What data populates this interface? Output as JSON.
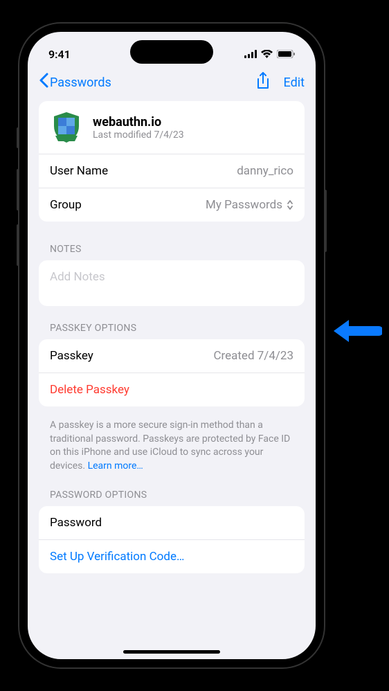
{
  "status": {
    "time": "9:41"
  },
  "nav": {
    "back_label": "Passwords",
    "edit_label": "Edit"
  },
  "site": {
    "name": "webauthn.io",
    "modified_label": "Last modified 7/4/23"
  },
  "details": {
    "username_label": "User Name",
    "username_value": "danny_rico",
    "group_label": "Group",
    "group_value": "My Passwords"
  },
  "notes": {
    "header": "NOTES",
    "placeholder": "Add Notes"
  },
  "passkey": {
    "header": "PASSKEY OPTIONS",
    "label": "Passkey",
    "created": "Created 7/4/23",
    "delete_label": "Delete Passkey",
    "footer": "A passkey is a more secure sign-in method than a traditional password. Passkeys are protected by Face ID on this iPhone and use iCloud to sync across your devices. ",
    "learn_more": "Learn more…"
  },
  "password": {
    "header": "PASSWORD OPTIONS",
    "label": "Password",
    "verification_label": "Set Up Verification Code…"
  }
}
